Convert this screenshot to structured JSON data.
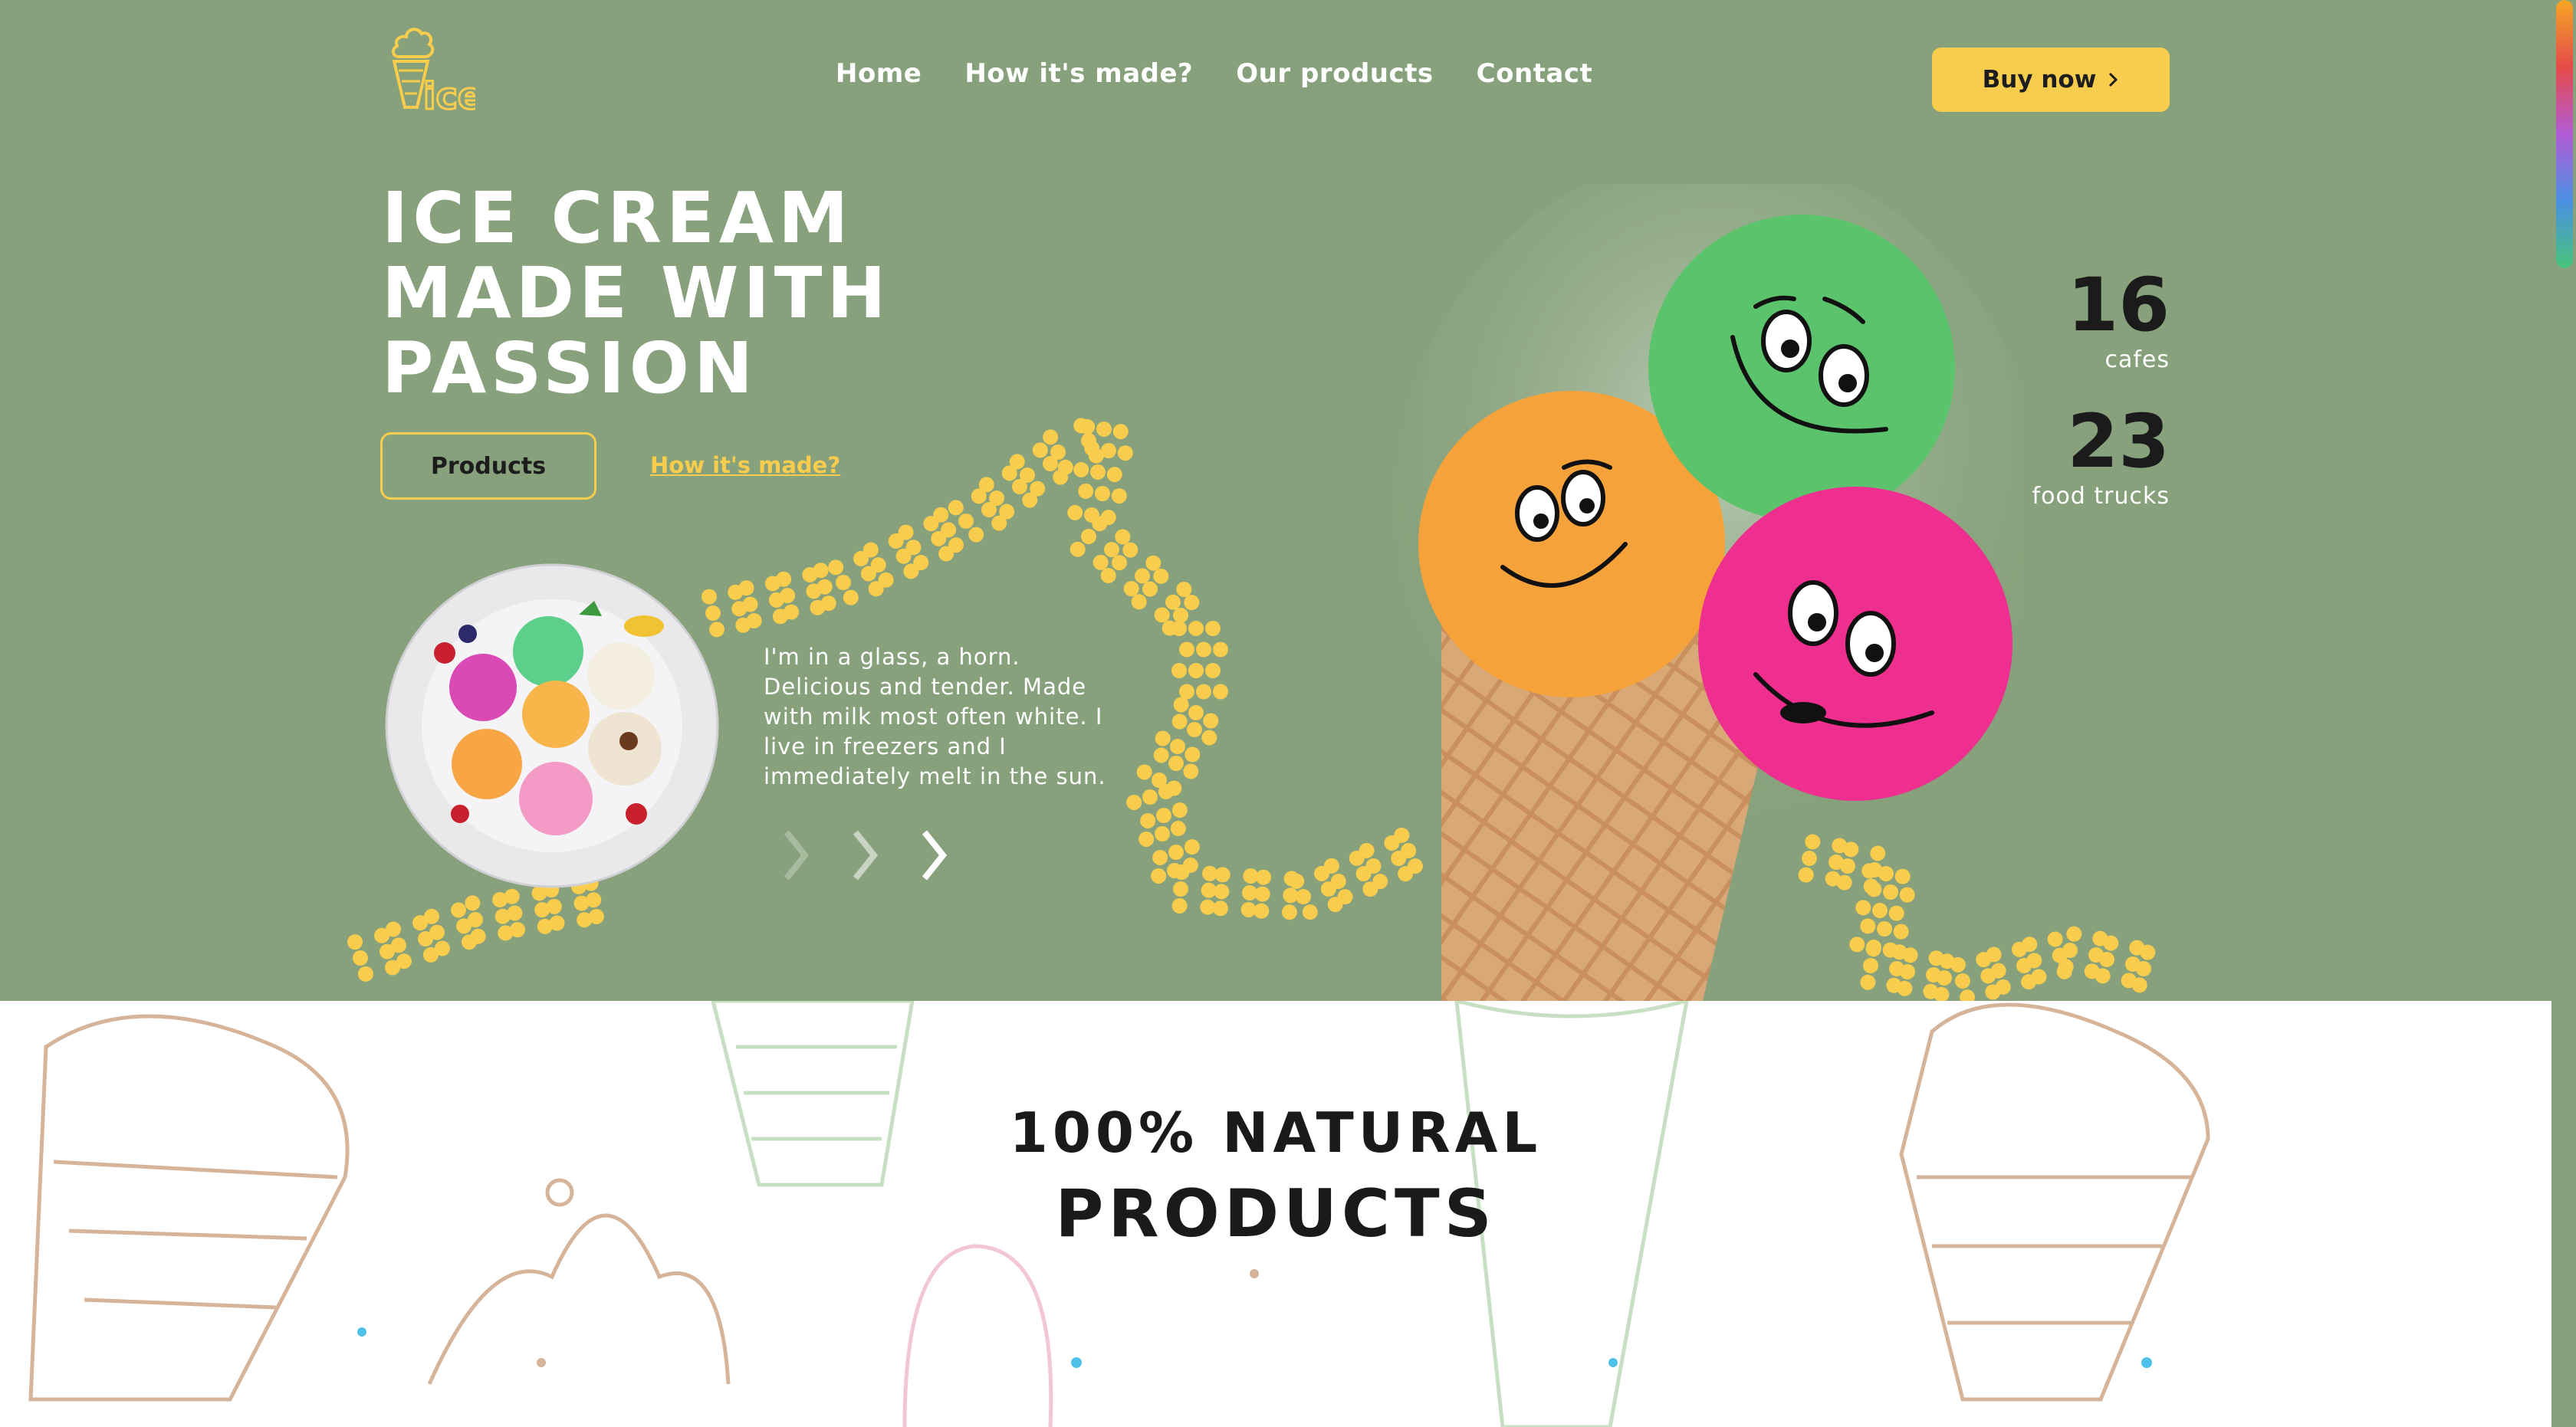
{
  "brand": {
    "logo_text": "ice"
  },
  "nav": {
    "items": [
      "Home",
      "How it's made?",
      "Our products",
      "Contact"
    ]
  },
  "header": {
    "buy_label": "Buy now"
  },
  "hero": {
    "title_line1": "ICE CREAM",
    "title_line2": "MADE WITH",
    "title_line3": "PASSION",
    "products_label": "Products",
    "how_label": "How it's made?",
    "blurb": "I'm in a glass, a horn. Delicious and tender. Made with milk most often white. I live in freezers and I immediately melt in the sun."
  },
  "stats": [
    {
      "value": "16",
      "label": "cafes"
    },
    {
      "value": "23",
      "label": "food trucks"
    }
  ],
  "section2": {
    "title_line1": "100% NATURAL",
    "title_line2": "PRODUCTS"
  },
  "colors": {
    "hero_bg": "#86a17b",
    "accent_yellow": "#f8cc4d",
    "scoop_green": "#5cc36d",
    "scoop_orange": "#f6a23a",
    "scoop_pink": "#ee2f8f"
  }
}
